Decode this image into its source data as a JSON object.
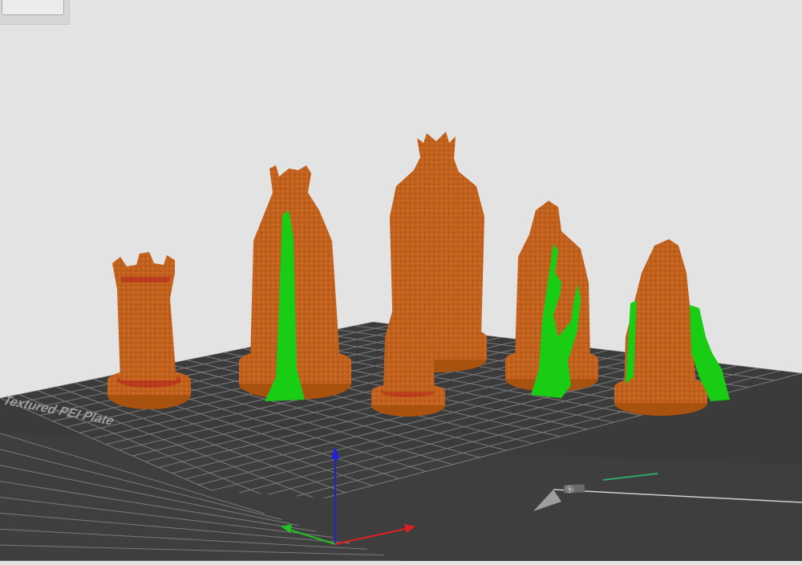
{
  "window": {
    "corner_button_label": ""
  },
  "build_plate": {
    "label": "Textured PEI Plate",
    "brand_mark": "ⓑ",
    "grid_color": "#7a7a7a",
    "plate_color": "#3b3b3b"
  },
  "colors": {
    "model": "#c2611d",
    "support": "#19cc14",
    "axis_x": "#e0201f",
    "axis_y": "#1fc21f",
    "axis_z": "#1f20e0"
  },
  "models": [
    {
      "name": "rook"
    },
    {
      "name": "queen"
    },
    {
      "name": "king"
    },
    {
      "name": "pawn"
    },
    {
      "name": "bishop"
    },
    {
      "name": "knight"
    }
  ]
}
